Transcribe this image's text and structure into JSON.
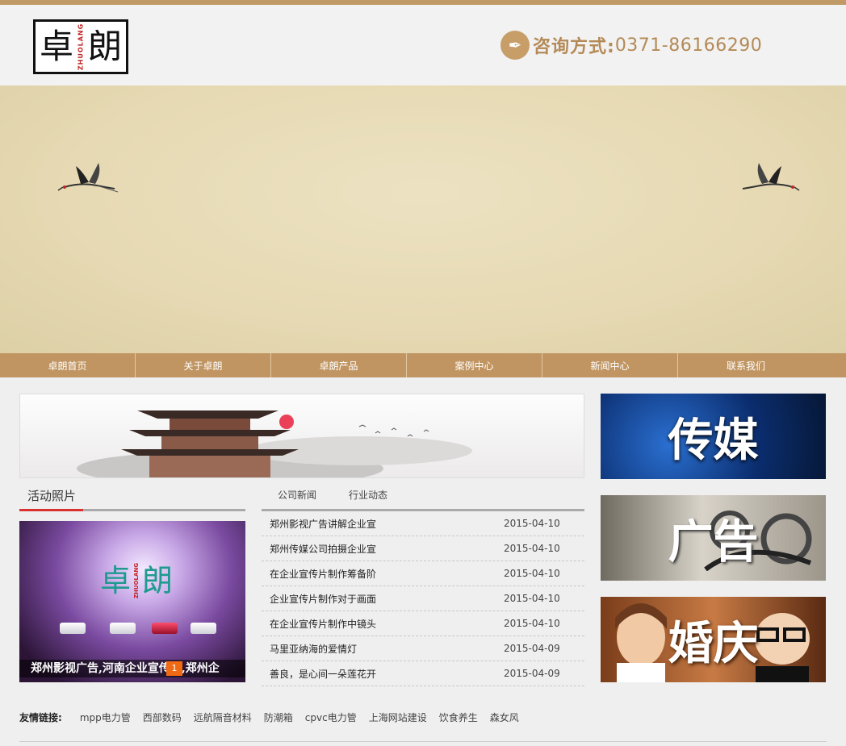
{
  "header": {
    "logo_left": "卓",
    "logo_mid": "ZHUOLANG",
    "logo_right": "朗",
    "contact_label": "咨询方式:",
    "contact_number": "0371-86166290"
  },
  "nav": {
    "items": [
      "卓朗首页",
      "关于卓朗",
      "卓朗产品",
      "案例中心",
      "新闻中心",
      "联系我们"
    ]
  },
  "photos": {
    "title": "活动照片",
    "caption": "郑州影视广告,河南企业宣传片,郑州企",
    "badge": "1"
  },
  "news": {
    "tabs": [
      "公司新闻",
      "行业动态"
    ],
    "items": [
      {
        "title": "郑州影视广告讲解企业宣",
        "date": "2015-04-10"
      },
      {
        "title": "郑州传媒公司拍摄企业宣",
        "date": "2015-04-10"
      },
      {
        "title": "在企业宣传片制作筹备阶",
        "date": "2015-04-10"
      },
      {
        "title": "企业宣传片制作对于画面",
        "date": "2015-04-10"
      },
      {
        "title": "在企业宣传片制作中镜头",
        "date": "2015-04-10"
      },
      {
        "title": "马里亚纳海的爱情灯",
        "date": "2015-04-09"
      },
      {
        "title": "善良，是心间一朵莲花开",
        "date": "2015-04-09"
      }
    ]
  },
  "side": {
    "card1": "传媒",
    "card2": "广告",
    "card3": "婚庆"
  },
  "links": {
    "label": "友情链接:",
    "items": [
      "mpp电力管",
      "西部数码",
      "远航隔音材料",
      "防潮箱",
      "cpvc电力管",
      "上海网站建设",
      "饮食养生",
      "森女风"
    ]
  },
  "colors": {
    "accent": "#c09561",
    "red": "#d93030",
    "badge": "#f06a14"
  }
}
